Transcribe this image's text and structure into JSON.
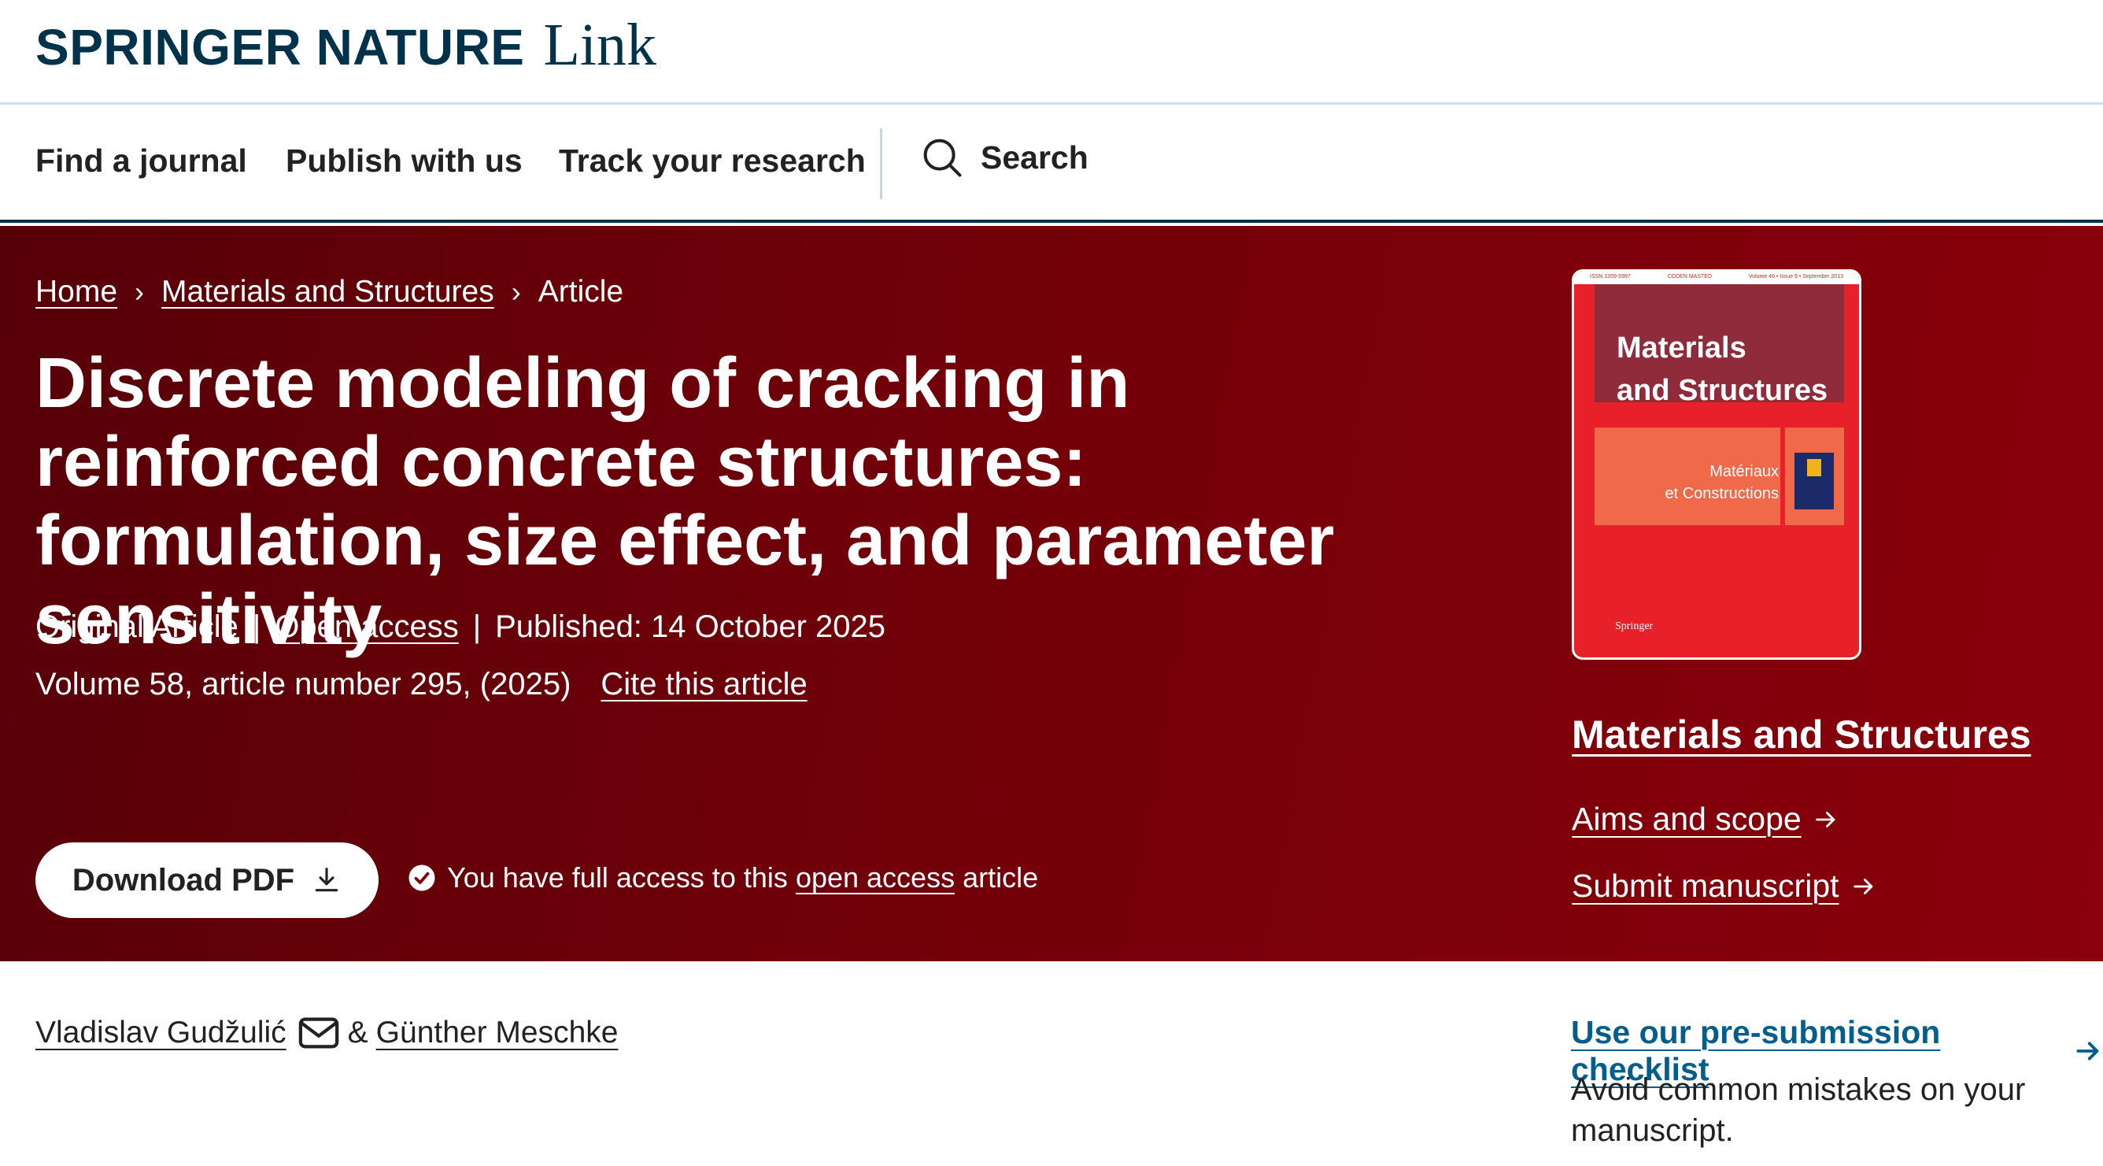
{
  "brand": {
    "name": "SPRINGER NATURE",
    "product": "Link"
  },
  "nav": {
    "find_journal": "Find a journal",
    "publish": "Publish with us",
    "track": "Track your research",
    "search": "Search"
  },
  "breadcrumb": {
    "home": "Home",
    "journal": "Materials and Structures",
    "current": "Article",
    "separator": "›"
  },
  "article": {
    "title": "Discrete modeling of cracking in reinforced concrete structures: formulation, size effect, and parameter sensitivity",
    "type": "Original Article",
    "access": "Open access",
    "published": "Published: 14 October 2025",
    "volume": "Volume 58, article number 295, (2025)",
    "cite": "Cite this article",
    "divider": "|"
  },
  "download": {
    "label": "Download PDF"
  },
  "access_note": {
    "prefix": "You have full access to this",
    "link": "open access",
    "suffix": "article"
  },
  "cover": {
    "header_left": "ISSN 1359-5997",
    "header_mid": "CODEN MASTED",
    "header_right": "Volume 46 • Issue 9 • September 2013",
    "title_line1": "Materials",
    "title_line2": "and Structures",
    "subtitle_line1": "Matériaux",
    "subtitle_line2": "et Constructions",
    "publisher": "Springer"
  },
  "journal": {
    "name": "Materials and Structures",
    "aims": "Aims and scope",
    "submit": "Submit manuscript"
  },
  "authors": {
    "first": "Vladislav Gudžulić",
    "amp": "&",
    "second": "Günther Meschke"
  },
  "checklist": {
    "link": "Use our pre-submission checklist",
    "description": "Avoid common mistakes on your manuscript."
  },
  "colors": {
    "hero": "#7d000a",
    "brand": "#01324b",
    "link_blue": "#025e8d",
    "cover_red": "#e8202a"
  },
  "icons": [
    "search-icon",
    "chevron-right-icon",
    "download-icon",
    "check-circle-icon",
    "arrow-right-icon",
    "mail-icon"
  ]
}
